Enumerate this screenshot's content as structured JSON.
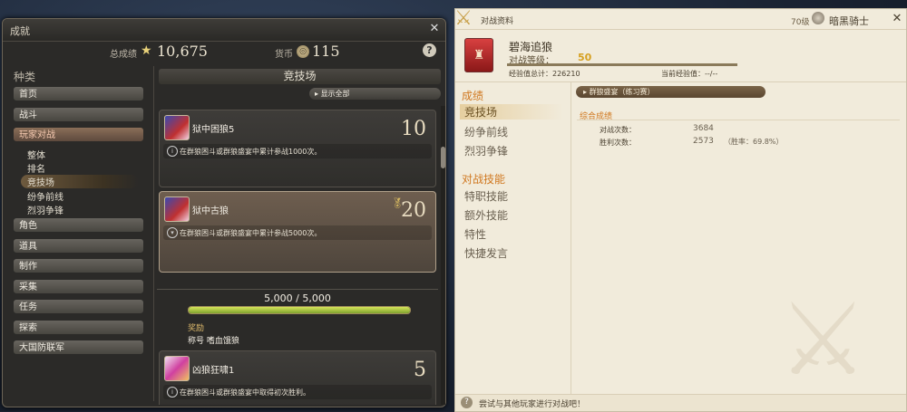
{
  "achievements_window": {
    "title": "成就",
    "total_label": "总成绩",
    "total_value": "10,675",
    "currency_label": "货币",
    "currency_value": "115",
    "help": "?",
    "category_heading": "种类",
    "categories": [
      "首页",
      "战斗",
      "玩家对战"
    ],
    "subcategories": [
      "整体",
      "排名",
      "竞技场",
      "纷争前线",
      "烈羽争锋"
    ],
    "categories_after": [
      "角色",
      "道具",
      "制作",
      "采集",
      "任务",
      "探索",
      "大国防联军"
    ],
    "section_title": "竞技场",
    "show_all": "显示全部",
    "items": [
      {
        "name": "狱中困狼5",
        "description": "在群狼困斗或群狼盛宴中累计参战1000次。",
        "points": "10"
      },
      {
        "name": "狱中古狼",
        "description": "在群狼困斗或群狼盛宴中累计参战5000次。",
        "points": "20"
      },
      {
        "name": "凶狼狂啸1",
        "description": "在群狼困斗或群狼盛宴中取得初次胜利。",
        "points": "5"
      }
    ],
    "progress_text": "5,000 / 5,000",
    "progress_fraction": 1.0,
    "reward_label": "奖励",
    "reward_value": "称号 嗜血饿狼"
  },
  "pvp_window": {
    "title": "对战资料",
    "level": "70级",
    "job": "暗黑骑士",
    "player_name": "碧海追狼",
    "rank_label": "对战等级：",
    "rank_value": "50",
    "exp_total": "经验值总计：226210",
    "exp_current": "当前经验值：--/--",
    "nav_heading_1": "成绩",
    "nav_group_1": [
      "竞技场",
      "纷争前线",
      "烈羽争锋"
    ],
    "nav_heading_2": "对战技能",
    "nav_group_2": [
      "特职技能",
      "额外技能",
      "特性",
      "快捷发言"
    ],
    "mode_pill": "群狼盛宴（练习赛）",
    "stats_heading": "综合成绩",
    "matches_label": "对战次数：",
    "matches_value": "3684",
    "wins_label": "胜利次数：",
    "wins_value": "2573",
    "win_rate": "（胜率：69.8%）",
    "footer_hint": "尝试与其他玩家进行对战吧！"
  },
  "colors": {
    "accent_orange": "#d07820",
    "rank_gold": "#d6a020",
    "progress_green": "#a8c83c"
  }
}
